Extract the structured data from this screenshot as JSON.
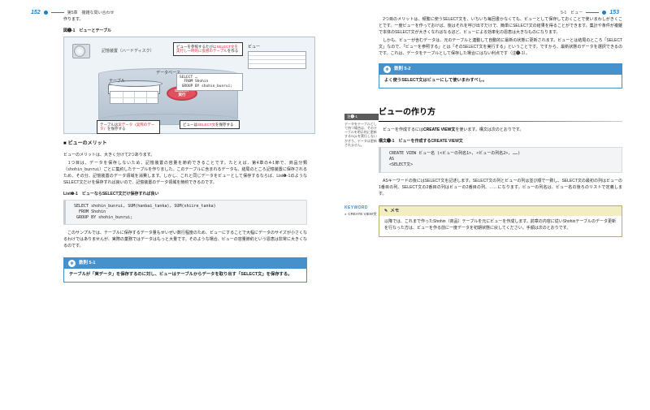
{
  "header": {
    "left_page_no": "152",
    "left_chapter": "第5章　複雑な問い合わせ",
    "right_section": "5-1　ビュー",
    "right_page_no": "153"
  },
  "left": {
    "intro_tail": "作ります。",
    "figcap": "図❶-1　ビューとテーブル",
    "fig": {
      "hdd_label": "記憶装置（ハードディスク）",
      "db_label": "データベース",
      "tbl_label": "テーブル",
      "select_badge": "SELECT\n実行",
      "code": "SELECT …\n  FROM Shohin\n GROUP BY shohin_bunrui;",
      "view_label": "ビュー",
      "note_top_pre": "ビューを参照するたびに",
      "note_top_em": "SELECT文を実行し一時的に仮想のテーブル",
      "note_top_post": "を作る",
      "note_bl_pre": "テーブルは",
      "note_bl_em": "実データ（実際のデータ）",
      "note_bl_post": "を保存する",
      "note_br_pre": "ビューは",
      "note_br_em": "SELECT文",
      "note_br_post": "を保存する"
    },
    "sec1": "ビューのメリット",
    "p1": "ビューのメリットは、大きく分けて2つあります。",
    "p2_a": "　1つ目は、データを保存しないため、記憶装置の容量を節約できることです。たとえば、第4章の4-1節で、商品分類（",
    "p2_code": "shohin_bunrui",
    "p2_b": "）ごとに集約したテーブルを作りました。このテーブルに含まれるデータも、結局のところ記憶装置に保存されるため、その分、記憶装置のデータ領域を消費します。しかし、これと同じデータをビューとして保存するならば、List❶-1のようなSELECT文だけを保存すれば良いので、記憶装置のデータ領域を節約できるのです。",
    "listcap": "List❶-1　ビューならSELECT文だけ保存すれば良い",
    "code1": "SELECT shohin_bunrui, SUM(hanbai_tanka), SUM(shiire_tanka)\n  FROM Shohin\n GROUP BY shohin_bunrui;",
    "p3": "　このサンプルでは、テーブルに保存するデータ量もせいぜい数行程度のため、ビューにすることで大幅にデータのサイズが小さくなるわけではありませんが、実際の業務ではデータはもっと大量です。そのような場合、ビューの容量節約という恩恵は非常に大きくなるのです。",
    "rule1_title": "鉄則 5-1",
    "rule1_body": "テーブルが「実データ」を保存するのに対し、ビューはテーブルからデータを取り出す「SELECT文」を保存する。"
  },
  "right": {
    "p1": "　2つ目のメリットは、頻繁に使うSELECT文を、いちいち毎回書かなくても、ビューとして保存しておくことで使いまわしがきくことです。一度ビューを作っておけば、後はそれを呼び出すだけで、簡単にSELECT文の結果を得ることができます。集計や条件が複雑で本体のSELECT文が大きくなればなるほど、ビューによる効率化の恩恵は大きなものになります。",
    "p2": "　しかも、ビューが含むデータは、元のテーブルと連動して自動的に最新の状態に更新されます。ビューとは結局のところ「SELECT文」なので、「ビューを参照する」とは「そのSELECT文を実行する」ということです。ですから、最新状態のデータを選択できるのです。これは、データをテーブルとして保存した場合にはない利点です",
    "p2_ref": "（注❶-1）。",
    "sidebar_head": "注❶-1",
    "sidebar_body": "データをテーブルとして持つ場合は、そのテーブルを明示的に更新するSQLを実行しないかぎり、データは更新されません。",
    "rule2_title": "鉄則 5-2",
    "rule2_body": "よく使うSELECT文はビューにして使いまわすべし。",
    "section_title": "ビューの作り方",
    "kw_label": "KEYWORD",
    "kw_item": "CREATE VIEW文",
    "p3_a": "　ビューを作成するには",
    "p3_kw": "CREATE VIEW文",
    "p3_b": "を使います。構文は次のとおりです。",
    "syntaxcap": "構文❶-1　ビューを作成するCREATE VIEW文",
    "code2": "CREATE VIEW ビュー名 (<ビューの列名1>, <ビューの列名2>, ……)\nAS\n<SELECT文>",
    "p4": "　ASキーワードの後にはSELECT文を記述します。SELECT文の列とビューの列は並び順で一致し、SELECT文の最初の列はビューの1番目の列、SELECT文の2番目の列はビューの2番目の列、……になります。ビューの列名は、ビュー名の後ろのリストで定義します。",
    "memo_title": "メモ",
    "memo_body": "以降では、これまで作ったShohin（商品）テーブルを元にビューを作成します。前章の内容に従いShohinテーブルのデータ更新を行なった方は、ビューを作る前に一度データを初期状態に戻してください。手順は次のとおりです。"
  }
}
